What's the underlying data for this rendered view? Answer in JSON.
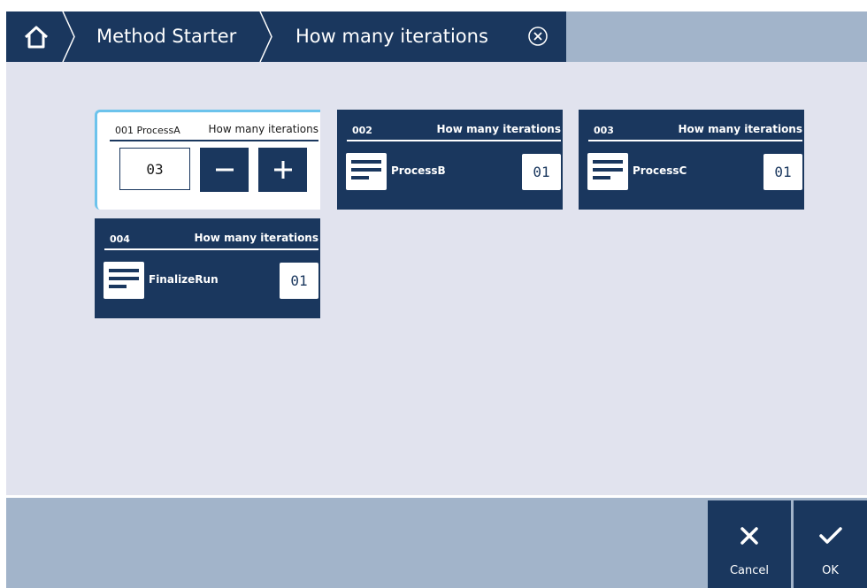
{
  "breadcrumb": {
    "home_icon": "home-icon",
    "items": [
      "Method Starter",
      "How many iterations"
    ],
    "close_icon": "circle-x-icon"
  },
  "colors": {
    "primary": "#1a375e",
    "accent_bar": "#a2b4ca",
    "background": "#e1e3ee",
    "selection": "#6cc3ec"
  },
  "cards": [
    {
      "number": "001",
      "name": "ProcessA",
      "question": "How many iterations",
      "value": "03",
      "selected": true
    },
    {
      "number": "002",
      "name": "ProcessB",
      "question": "How many iterations",
      "value": "01",
      "selected": false
    },
    {
      "number": "003",
      "name": "ProcessC",
      "question": "How many iterations",
      "value": "01",
      "selected": false
    },
    {
      "number": "004",
      "name": "FinalizeRun",
      "question": "How many iterations",
      "value": "01",
      "selected": false
    }
  ],
  "stepper": {
    "minus_icon": "minus-icon",
    "plus_icon": "plus-icon"
  },
  "footer": {
    "cancel_label": "Cancel",
    "ok_label": "OK"
  }
}
